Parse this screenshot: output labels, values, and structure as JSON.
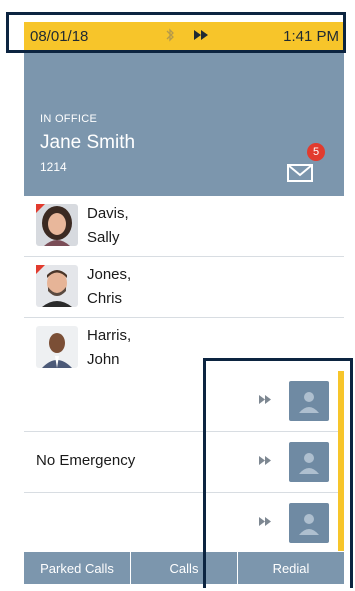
{
  "status_bar": {
    "date": "08/01/18",
    "time": "1:41 PM",
    "icons": [
      "bluetooth-icon",
      "fast-forward-icon"
    ],
    "color": "#f7c52a"
  },
  "header": {
    "presence": "IN OFFICE",
    "user_name": "Jane Smith",
    "extension": "1214",
    "voicemail_count": "5",
    "color": "#7c96ad"
  },
  "contacts": [
    {
      "last": "Davis,",
      "first": "Sally",
      "status": "busy"
    },
    {
      "last": "Jones,",
      "first": "Chris",
      "status": "busy"
    },
    {
      "last": "Harris,",
      "first": "John",
      "status": "available"
    }
  ],
  "call_keys": [
    {
      "label": ""
    },
    {
      "label": "No Emergency"
    },
    {
      "label": ""
    }
  ],
  "softkeys": [
    "Parked Calls",
    "Calls",
    "Redial"
  ]
}
